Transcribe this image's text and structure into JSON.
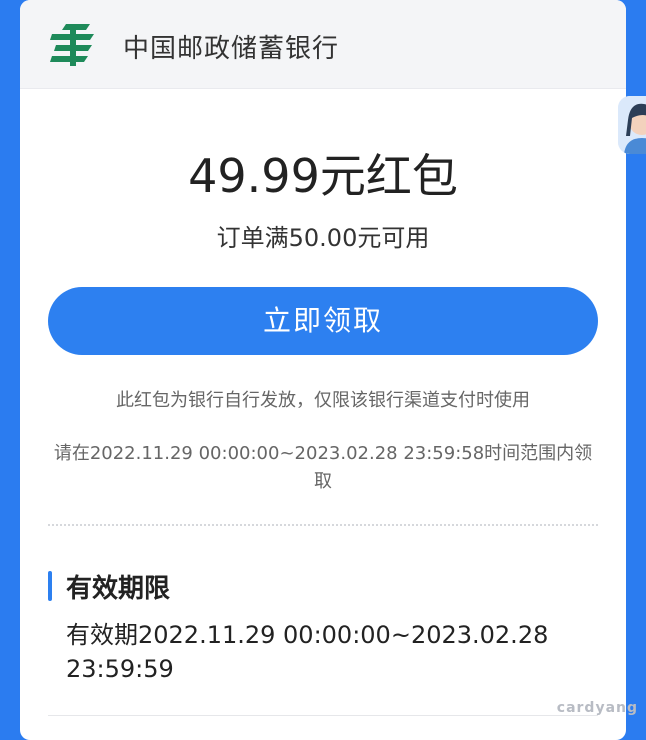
{
  "header": {
    "bank_name": "中国邮政储蓄银行",
    "logo_icon": "postal-savings-logo-icon",
    "brand_color": "#1e8a5a"
  },
  "coupon": {
    "title": "49.99元红包",
    "condition": "订单满50.00元可用",
    "claim_label": "立即领取",
    "note": "此红包为银行自行发放，仅限该银行渠道支付时使用",
    "time_range": "请在2022.11.29 00:00:00~2023.02.28 23:59:58时间范围内领取"
  },
  "validity": {
    "section_title": "有效期限",
    "text": "有效期2022.11.29 00:00:00~2023.02.28 23:59:59"
  },
  "side": {
    "icon": "customer-service-avatar-icon"
  },
  "watermark": "cardyang",
  "colors": {
    "accent": "#2d80f0",
    "page_background": "#2b7cf0",
    "card_background": "#ffffff"
  }
}
